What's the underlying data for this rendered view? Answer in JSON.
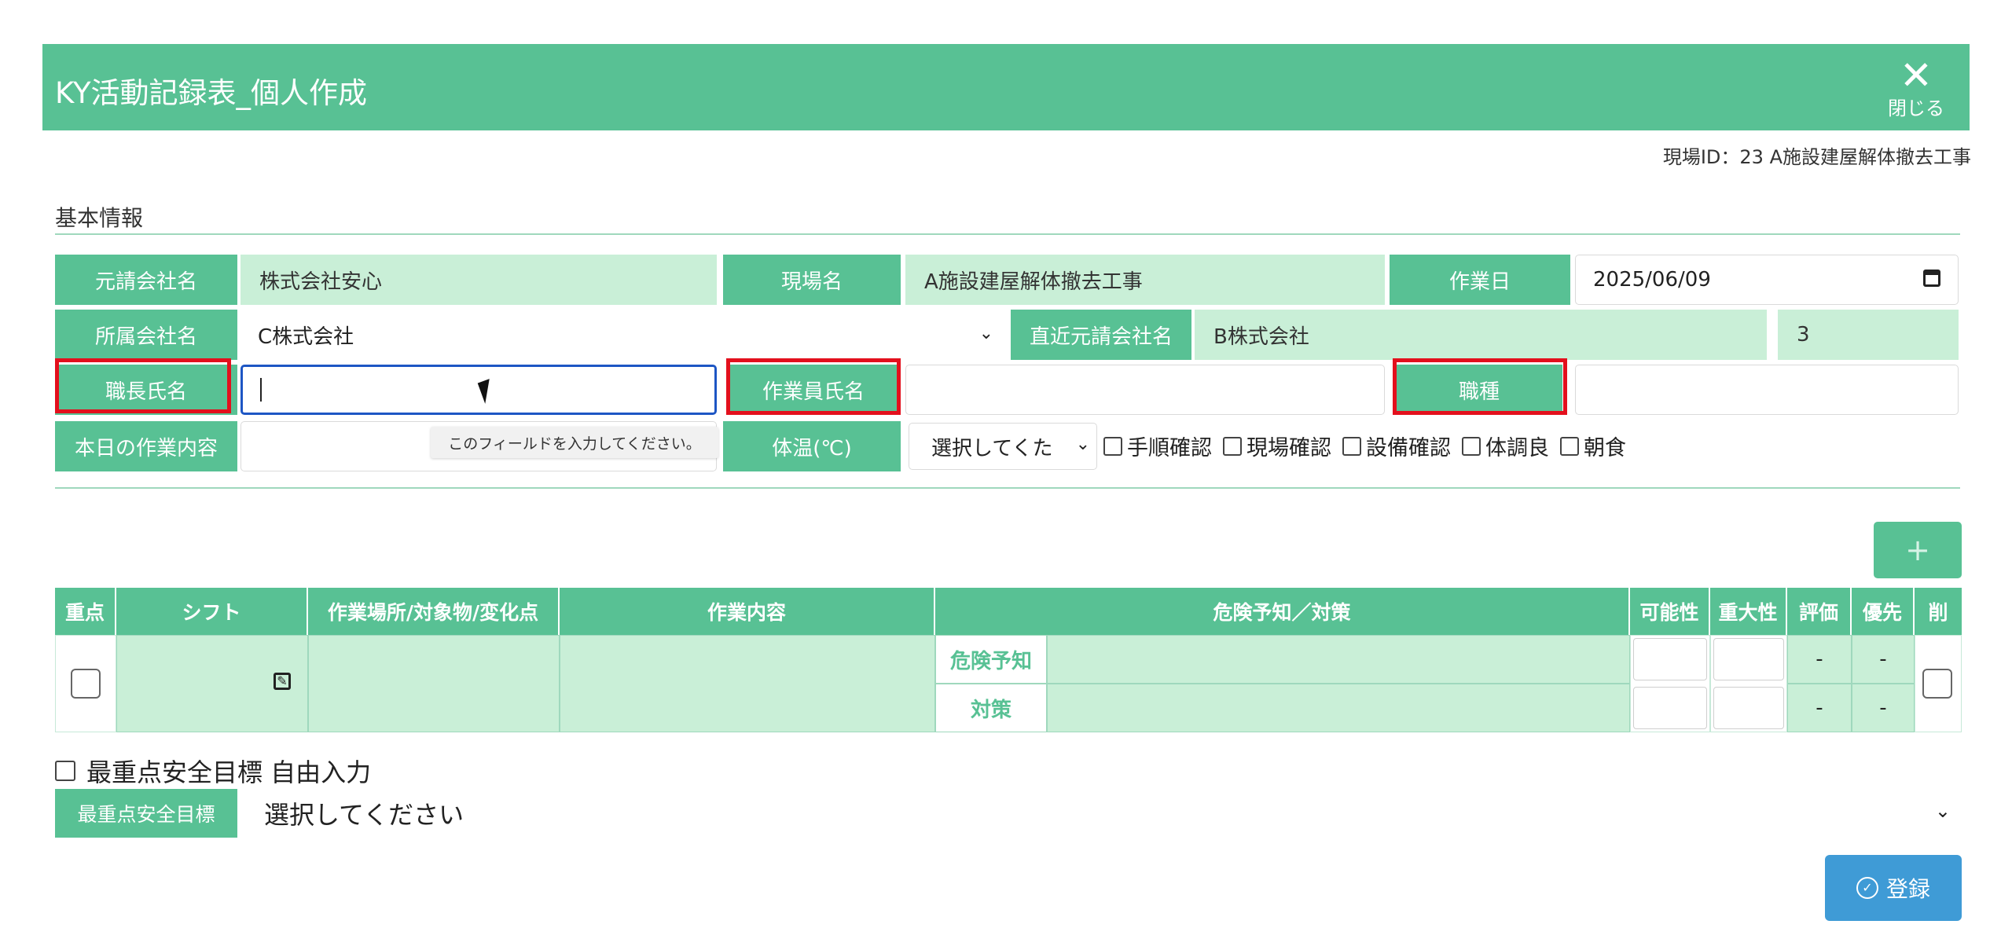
{
  "window": {
    "title": "KY活動記録表_個人作成",
    "close_label": "閉じる"
  },
  "site": {
    "id_text": "現場ID：23 A施設建屋解体撤去工事"
  },
  "basic_info": {
    "section_title": "基本情報",
    "prime_contractor": {
      "label": "元請会社名",
      "value": "株式会社安心"
    },
    "site_name": {
      "label": "現場名",
      "value": "A施設建屋解体撤去工事"
    },
    "work_date": {
      "label": "作業日",
      "value": "2025/06/09"
    },
    "affiliated_company": {
      "label": "所属会社名",
      "value": "C株式会社"
    },
    "direct_contractor": {
      "label": "直近元請会社名",
      "value": "B株式会社"
    },
    "count_value": "3",
    "foreman_name": {
      "label": "職長氏名",
      "value": ""
    },
    "worker_name": {
      "label": "作業員氏名",
      "value": ""
    },
    "job_type": {
      "label": "職種",
      "value": ""
    },
    "today_work": {
      "label": "本日の作業内容",
      "value": ""
    },
    "temperature": {
      "label": "体温(℃)",
      "selected": "選択してくた"
    },
    "checks": [
      "手順確認",
      "現場確認",
      "設備確認",
      "体調良",
      "朝食"
    ],
    "tooltip": "このフィールドを入力してください。"
  },
  "table": {
    "add_label": "+",
    "headers": [
      "重点",
      "シフト",
      "作業場所/対象物/変化点",
      "作業内容",
      "危険予知／対策",
      "可能性",
      "重大性",
      "評価",
      "優先",
      "削"
    ],
    "row": {
      "hazard_label": "危険予知",
      "measure_label": "対策",
      "eval_1": "-",
      "priority_1": "-",
      "eval_2": "-",
      "priority_2": "-"
    }
  },
  "safety_goal": {
    "free_input_label": "最重点安全目標 自由入力",
    "label": "最重点安全目標",
    "selected": "選択してください"
  },
  "register_label": "登録",
  "colors": {
    "header_green": "#58c194",
    "value_green": "#c9efd7",
    "highlight_red": "#e3101d",
    "button_blue": "#3f9bd6"
  }
}
